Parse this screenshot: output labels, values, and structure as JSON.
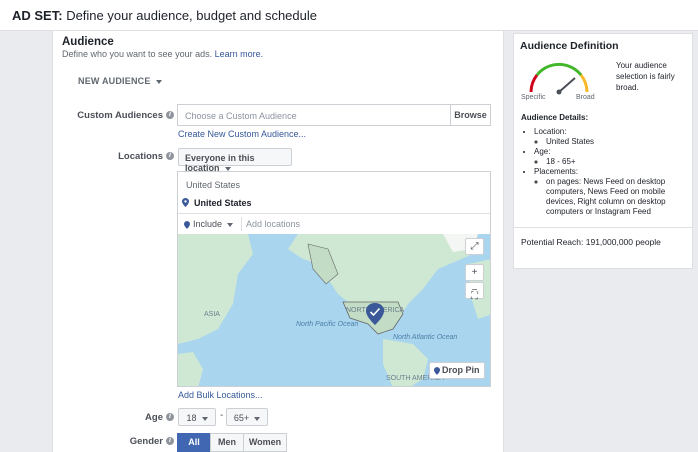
{
  "header": {
    "prefix": "AD SET:",
    "title": "Define your audience, budget and schedule"
  },
  "audience": {
    "title": "Audience",
    "subtitle": "Define who you want to see your ads.",
    "learn_more": "Learn more.",
    "new_audience": "NEW AUDIENCE"
  },
  "custom_audiences": {
    "label": "Custom Audiences",
    "placeholder": "Choose a Custom Audience",
    "browse": "Browse",
    "create_link": "Create New Custom Audience..."
  },
  "locations": {
    "label": "Locations",
    "selected": "Everyone in this location",
    "list_header": "United States",
    "item": "United States",
    "include": "Include",
    "add_placeholder": "Add locations",
    "map_labels": {
      "asia": "ASIA",
      "north_pacific": "North Pacific Ocean",
      "north_america": "NORTH AMERICA",
      "north_atlantic": "North Atlantic Ocean",
      "south_america": "SOUTH AMERICA"
    },
    "drop_pin": "Drop Pin",
    "bulk_link": "Add Bulk Locations..."
  },
  "age": {
    "label": "Age",
    "min": "18",
    "max": "65+",
    "separator": "-"
  },
  "gender": {
    "label": "Gender",
    "options": [
      "All",
      "Men",
      "Women"
    ],
    "selected": "All"
  },
  "definition": {
    "title": "Audience Definition",
    "description": "Your audience selection is fairly broad.",
    "gauge_left": "Specific",
    "gauge_right": "Broad",
    "details_title": "Audience Details:",
    "location_label": "Location:",
    "location_value": "United States",
    "age_label": "Age:",
    "age_value": "18 - 65+",
    "placements_label": "Placements:",
    "placements_value": "on pages: News Feed on desktop computers, News Feed on mobile devices, Right column on desktop computers or Instagram Feed",
    "reach": "Potential Reach: 191,000,000 people"
  },
  "colors": {
    "brand_blue": "#4267b2",
    "link": "#365899",
    "map_water": "#a9d5ee",
    "map_land": "#cfe8d4",
    "pin": "#3b5998"
  }
}
